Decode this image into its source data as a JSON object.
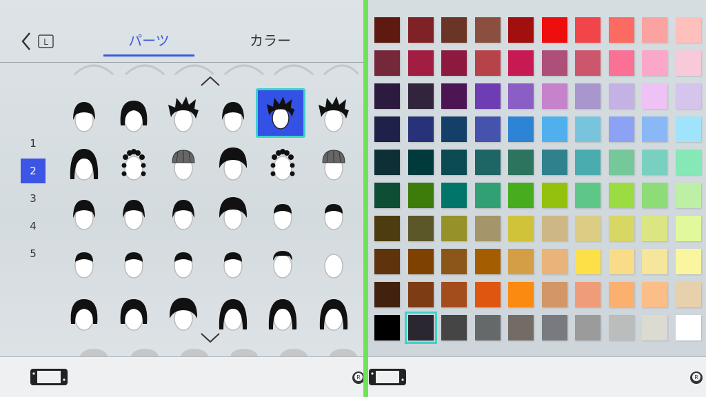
{
  "tabs": {
    "parts": "パーツ",
    "color": "カラー"
  },
  "back_button_key": "L",
  "pages": [
    "1",
    "2",
    "3",
    "4",
    "5"
  ],
  "active_page": "2",
  "footer": {
    "r_button_key": "R"
  },
  "colors": {
    "accent": "#3a5ad9",
    "selection_border": "#3ed2c9",
    "divider": "#6ee35a"
  },
  "hair_grid": {
    "selected_row": 0,
    "selected_col": 4,
    "icons": [
      [
        "hair-short-messy-icon",
        "hair-bob-icon",
        "hair-spiky-icon",
        "hair-medium-icon",
        "hair-spiky-parted-icon",
        "hair-spiky-wild-icon"
      ],
      [
        "hair-long-wavy-icon",
        "hair-braided-icon",
        "hair-beanie-icon",
        "hair-bowl-icon",
        "hair-curly-icon",
        "hair-knit-cap-icon"
      ],
      [
        "hair-crop-icon",
        "hair-crop-side-icon",
        "hair-widows-peak-icon",
        "hair-mushroom-icon",
        "hair-flattop-icon",
        "hair-flat-fringe-icon"
      ],
      [
        "hair-buzz-icon",
        "hair-buzz-side-icon",
        "hair-buzz-top-icon",
        "hair-short-side-icon",
        "hair-balding-icon",
        "hair-bald-icon"
      ],
      [
        "hair-bob-full-icon",
        "hair-bob-rounded-icon",
        "hair-helmet-icon",
        "hair-long-straight-icon",
        "hair-long-layered-icon",
        "hair-long-bangs-icon"
      ]
    ]
  },
  "color_grid": {
    "selected_row": 9,
    "selected_col": 1,
    "rows": [
      [
        "#5e1a10",
        "#7f2226",
        "#6a3426",
        "#8b4f3f",
        "#a1100f",
        "#ef0e0e",
        "#f2454a",
        "#fb6b62",
        "#fba3a1",
        "#fdc0bc"
      ],
      [
        "#75283a",
        "#a11d42",
        "#8d1a3e",
        "#b8424a",
        "#c71a53",
        "#ad4f79",
        "#cc566c",
        "#fb7095",
        "#fba7c9",
        "#f8c9d9"
      ],
      [
        "#2d1a3f",
        "#32243d",
        "#4d1652",
        "#6e3cb3",
        "#8b5ec5",
        "#c683cc",
        "#a996cc",
        "#c4b2e5",
        "#eec2f4",
        "#d5c4ec"
      ],
      [
        "#1e2148",
        "#273278",
        "#133f69",
        "#4653ad",
        "#2e84d4",
        "#50b0ee",
        "#78c4dc",
        "#8ba2f5",
        "#8ab8f6",
        "#a0e3fb"
      ],
      [
        "#0f2f37",
        "#003a3a",
        "#0c4a54",
        "#1e6566",
        "#2d735d",
        "#30808e",
        "#4bacaf",
        "#76c79a",
        "#79d0c1",
        "#86e8b6"
      ],
      [
        "#0d4e34",
        "#3d7c0a",
        "#017567",
        "#32a075",
        "#48ac1f",
        "#94c10e",
        "#5ec787",
        "#9bdc43",
        "#8edc78",
        "#bdf0a4"
      ],
      [
        "#4d3c10",
        "#5b5729",
        "#969129",
        "#a4966a",
        "#d0c239",
        "#cdb786",
        "#dbce84",
        "#d7d764",
        "#dbe682",
        "#e1f89c"
      ],
      [
        "#5f330b",
        "#7e4101",
        "#8b561a",
        "#a45e01",
        "#d39e45",
        "#e8b47a",
        "#fde048",
        "#f8dc88",
        "#f6e69b",
        "#f9f69f"
      ],
      [
        "#43210f",
        "#7d3c13",
        "#a34d1d",
        "#df5610",
        "#fb8a10",
        "#d39767",
        "#ef9d78",
        "#fbb06f",
        "#fbbe88",
        "#e6d1ac"
      ],
      [
        "#000000",
        "#2b2730",
        "#454545",
        "#666969",
        "#736c64",
        "#787a80",
        "#9b9b9c",
        "#bbbcbc",
        "#dcdbd2",
        "#ffffff"
      ]
    ]
  }
}
